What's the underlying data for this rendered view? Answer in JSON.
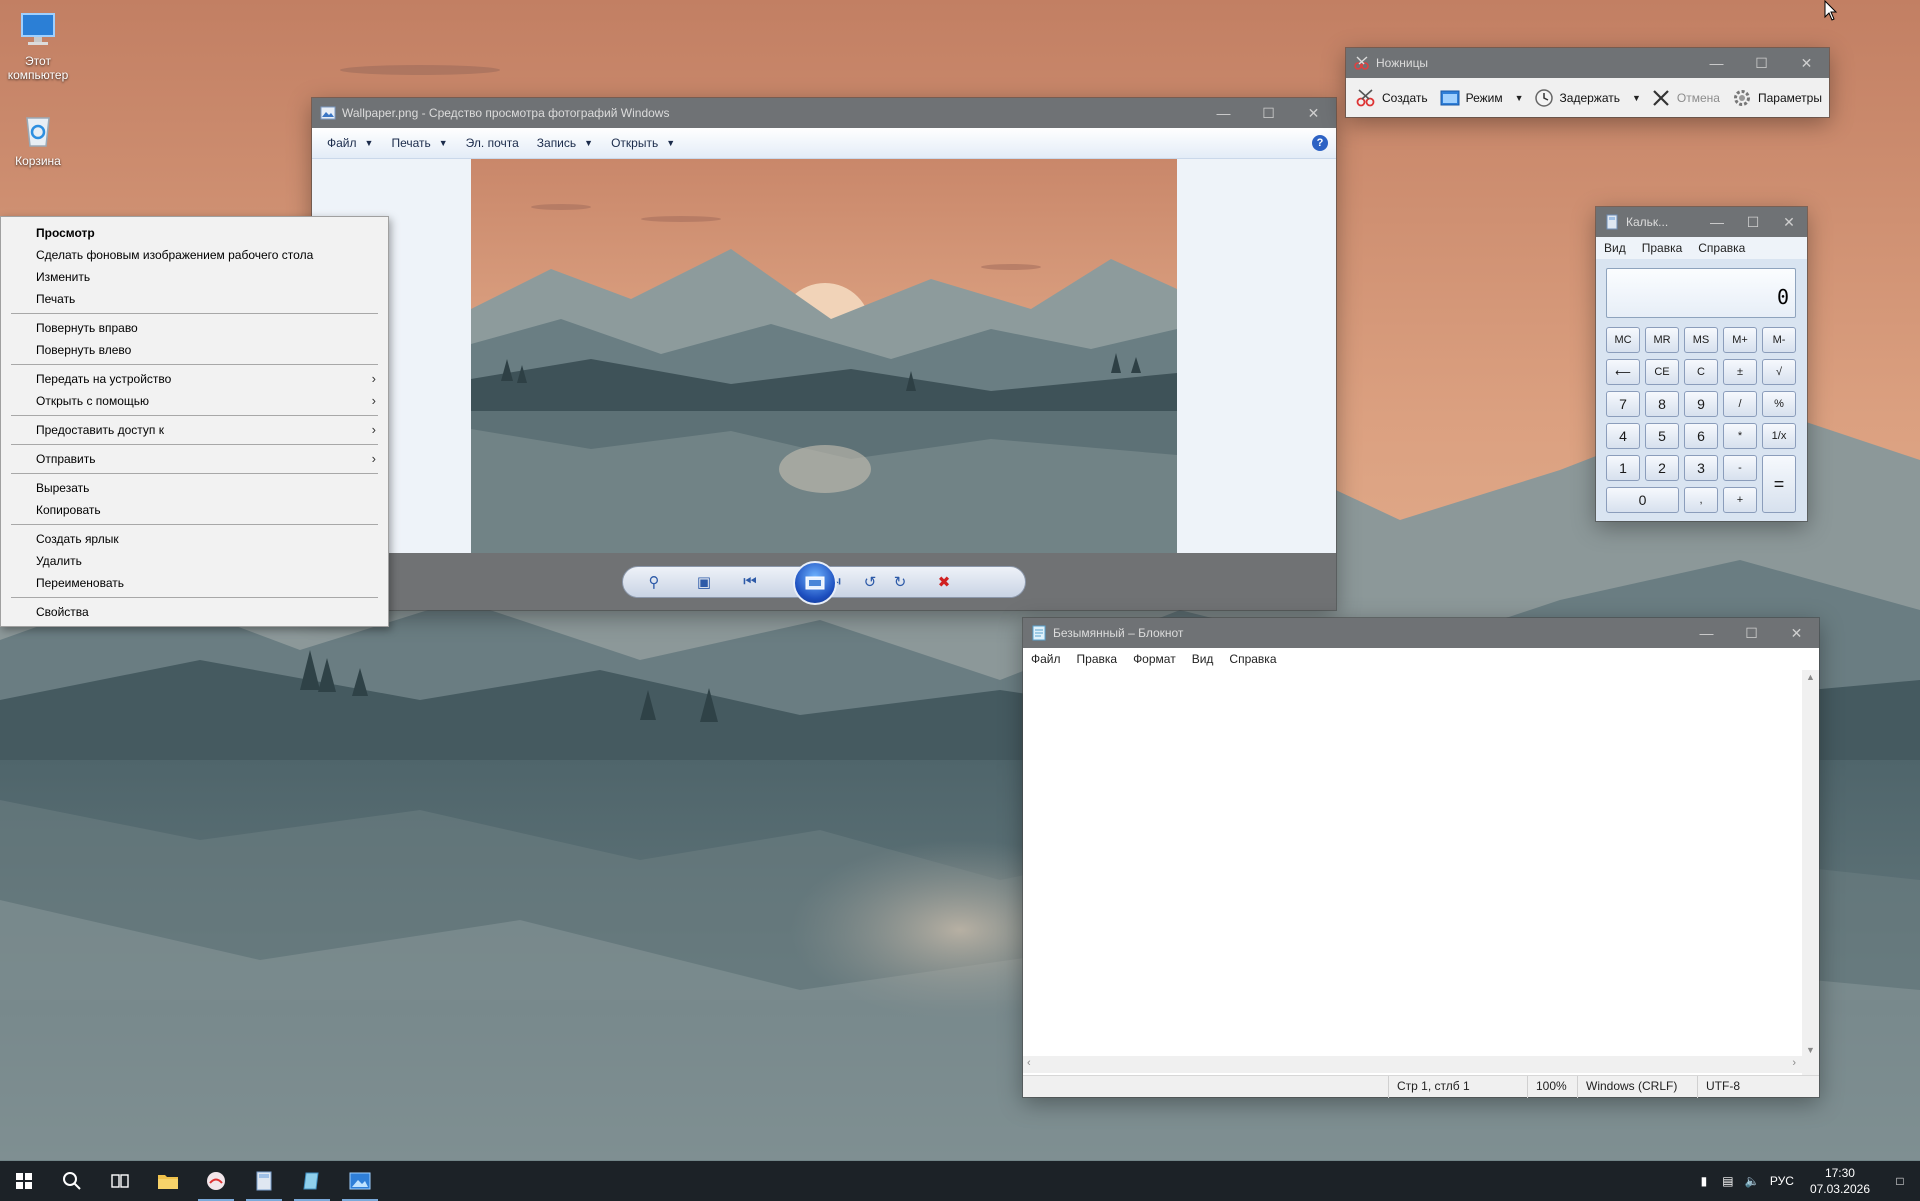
{
  "desktop": {
    "icons": [
      {
        "label": "Этот компьютер"
      },
      {
        "label": "Корзина"
      }
    ]
  },
  "photo_viewer": {
    "title": "Wallpaper.png - Средство просмотра фотографий Windows",
    "menu": [
      {
        "label": "Файл",
        "dropdown": true
      },
      {
        "label": "Печать",
        "dropdown": true
      },
      {
        "label": "Эл. почта",
        "dropdown": false
      },
      {
        "label": "Запись",
        "dropdown": true
      },
      {
        "label": "Открыть",
        "dropdown": true
      }
    ],
    "help": "?"
  },
  "context_menu": {
    "items": [
      {
        "type": "item",
        "label": "Просмотр",
        "bold": true
      },
      {
        "type": "item",
        "label": "Сделать фоновым изображением рабочего стола"
      },
      {
        "type": "item",
        "label": "Изменить"
      },
      {
        "type": "item",
        "label": "Печать"
      },
      {
        "type": "sep"
      },
      {
        "type": "item",
        "label": "Повернуть вправо"
      },
      {
        "type": "item",
        "label": "Повернуть влево"
      },
      {
        "type": "sep"
      },
      {
        "type": "item",
        "label": "Передать на устройство",
        "submenu": true
      },
      {
        "type": "item",
        "label": "Открыть с помощью",
        "submenu": true
      },
      {
        "type": "sep"
      },
      {
        "type": "item",
        "label": "Предоставить доступ к",
        "submenu": true
      },
      {
        "type": "sep"
      },
      {
        "type": "item",
        "label": "Отправить",
        "submenu": true
      },
      {
        "type": "sep"
      },
      {
        "type": "item",
        "label": "Вырезать"
      },
      {
        "type": "item",
        "label": "Копировать"
      },
      {
        "type": "sep"
      },
      {
        "type": "item",
        "label": "Создать ярлык"
      },
      {
        "type": "item",
        "label": "Удалить"
      },
      {
        "type": "item",
        "label": "Переименовать"
      },
      {
        "type": "sep"
      },
      {
        "type": "item",
        "label": "Свойства"
      }
    ]
  },
  "snipping_tool": {
    "title": "Ножницы",
    "buttons": {
      "new": "Создать",
      "mode": "Режим",
      "delay": "Задержать",
      "cancel": "Отмена",
      "options": "Параметры"
    }
  },
  "calculator": {
    "title": "Кальк...",
    "menu": [
      "Вид",
      "Правка",
      "Справка"
    ],
    "display": "0",
    "rows": [
      [
        "MC",
        "MR",
        "MS",
        "M+",
        "M-"
      ],
      [
        "⟵",
        "CE",
        "C",
        "±",
        "√"
      ],
      [
        "7",
        "8",
        "9",
        "/",
        "%"
      ],
      [
        "4",
        "5",
        "6",
        "*",
        "1/x"
      ],
      [
        "1",
        "2",
        "3",
        "-",
        "="
      ],
      [
        "0",
        ",",
        "+"
      ]
    ]
  },
  "notepad": {
    "title": "Безымянный – Блокнот",
    "menu": [
      "Файл",
      "Правка",
      "Формат",
      "Вид",
      "Справка"
    ],
    "status": {
      "position": "Стр 1, стлб 1",
      "zoom": "100%",
      "line_endings": "Windows (CRLF)",
      "encoding": "UTF-8"
    }
  },
  "taskbar": {
    "language": "РУС",
    "time": "17:30",
    "date": "07.03.2026"
  },
  "colors": {
    "sky_top": "#c8876a",
    "sky_bottom": "#e0a583",
    "mountain_far": "#7e8f93",
    "mountain_mid": "#5e7379",
    "mountain_near": "#3d5056",
    "lake": "#5c6f75",
    "taskbar": "#1c2227",
    "titlebar": "#6f7275"
  }
}
